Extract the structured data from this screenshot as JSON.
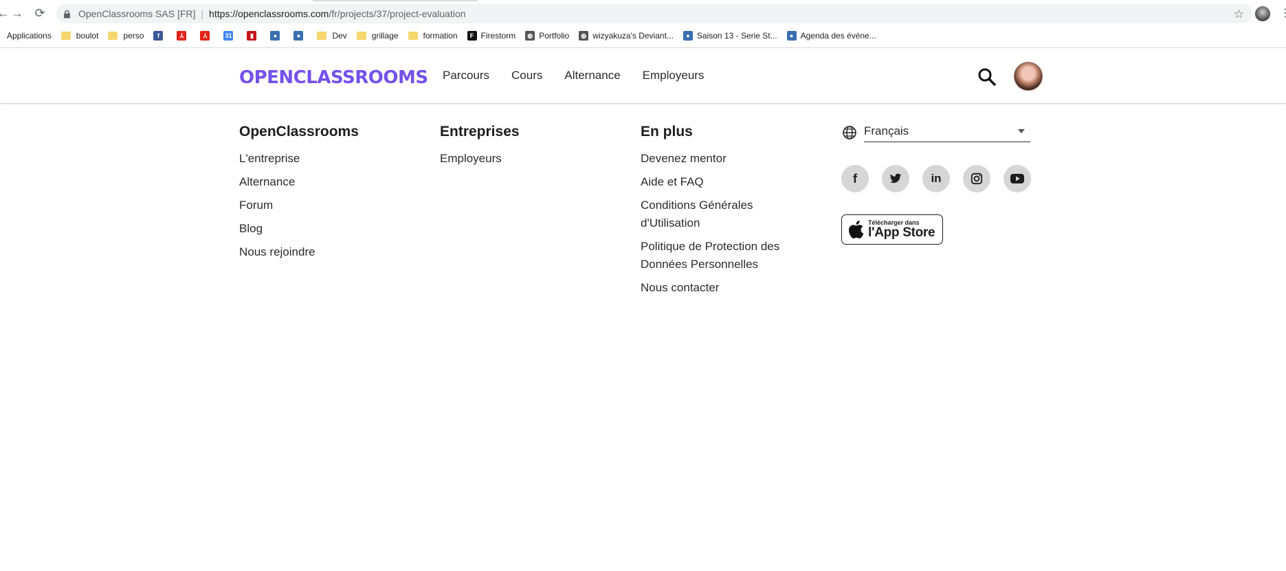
{
  "browser": {
    "site_identity": "OpenClassrooms SAS [FR]",
    "url_host": "https://openclassrooms.com",
    "url_path": "/fr/projects/37/project-evaluation",
    "bookmarks": [
      {
        "label": "Applications",
        "icon": "apps-icon"
      },
      {
        "label": "boulot",
        "icon": "folder-icon"
      },
      {
        "label": "perso",
        "icon": "folder-icon"
      },
      {
        "label": "",
        "icon": "facebook-icon"
      },
      {
        "label": "",
        "icon": "pdf-icon"
      },
      {
        "label": "",
        "icon": "pdf-icon"
      },
      {
        "label": "",
        "icon": "calendar-icon"
      },
      {
        "label": "",
        "icon": "news-icon"
      },
      {
        "label": "",
        "icon": "site-icon"
      },
      {
        "label": "",
        "icon": "site-icon"
      },
      {
        "label": "Dev",
        "icon": "folder-icon"
      },
      {
        "label": "grillage",
        "icon": "folder-icon"
      },
      {
        "label": "formation",
        "icon": "folder-icon"
      },
      {
        "label": "Firestorm",
        "icon": "firestorm-icon"
      },
      {
        "label": "Portfolio",
        "icon": "globe-icon"
      },
      {
        "label": "wizyakuza's Deviant...",
        "icon": "globe-icon"
      },
      {
        "label": "Saison 13 - Serie St...",
        "icon": "site-icon"
      },
      {
        "label": "Agenda des évène...",
        "icon": "site-icon"
      }
    ]
  },
  "header": {
    "logo_text": "OPENCLASSROOMS",
    "nav": [
      "Parcours",
      "Cours",
      "Alternance",
      "Employeurs"
    ]
  },
  "footer": {
    "columns": [
      {
        "title": "OpenClassrooms",
        "links": [
          "L'entreprise",
          "Alternance",
          "Forum",
          "Blog",
          "Nous rejoindre"
        ]
      },
      {
        "title": "Entreprises",
        "links": [
          "Employeurs"
        ]
      },
      {
        "title": "En plus",
        "links": [
          "Devenez mentor",
          "Aide et FAQ",
          "Conditions Générales d'Utilisation",
          "Politique de Protection des Données Personnelles",
          "Nous contacter"
        ]
      }
    ],
    "language": "Français",
    "socials": [
      "facebook-icon",
      "twitter-icon",
      "linkedin-icon",
      "instagram-icon",
      "youtube-icon"
    ],
    "appstore_small": "Télécharger dans",
    "appstore_big": "l'App Store"
  },
  "colors": {
    "brand": "#7451eb"
  }
}
